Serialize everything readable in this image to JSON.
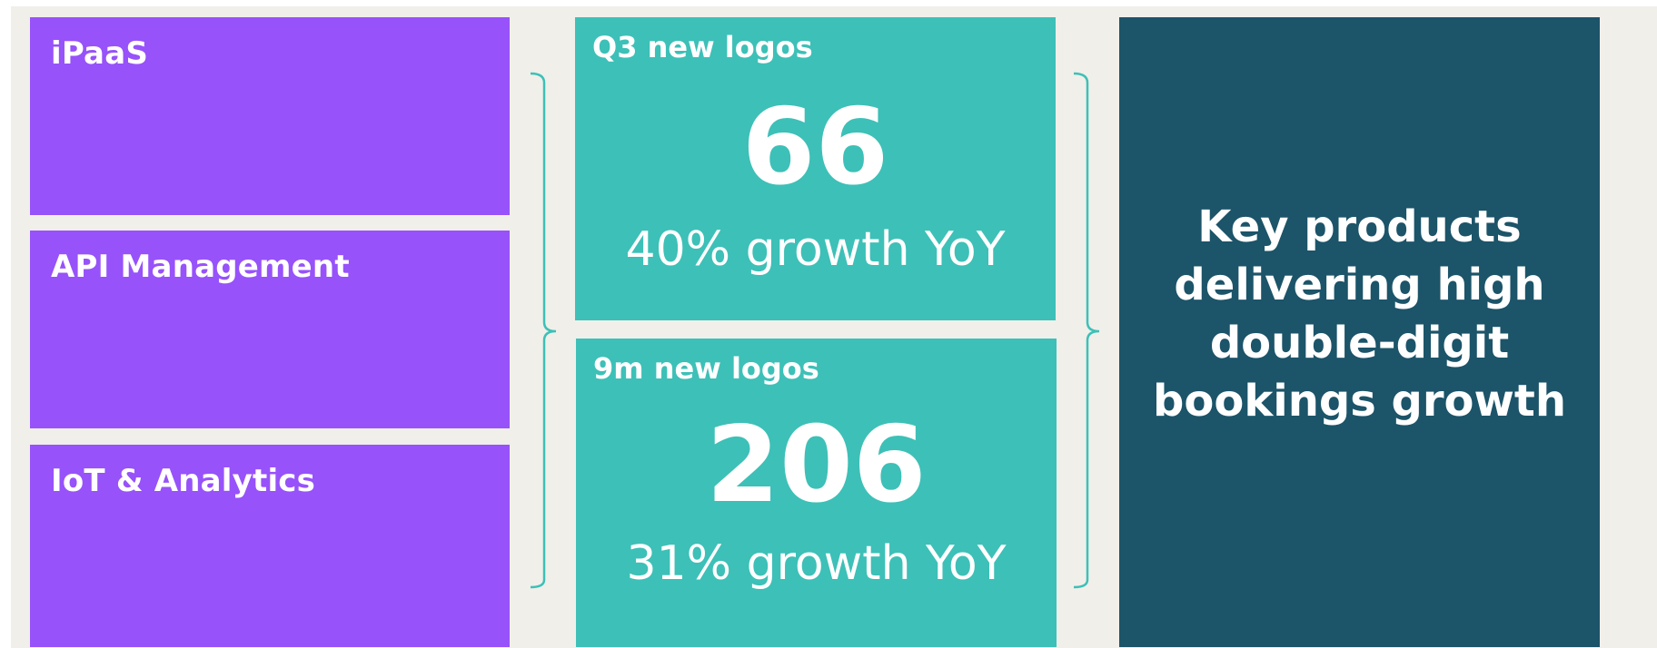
{
  "products": {
    "items": [
      {
        "label": "iPaaS"
      },
      {
        "label": "API Management"
      },
      {
        "label": "IoT & Analytics"
      }
    ]
  },
  "metrics": {
    "q3": {
      "title": "Q3 new logos",
      "value": "66",
      "growth": "40% growth YoY"
    },
    "nine_month": {
      "title": "9m new logos",
      "value": "206",
      "growth": "31% growth YoY"
    }
  },
  "summary": {
    "text": "Key products delivering high double-digit bookings growth"
  },
  "colors": {
    "background": "#f0efea",
    "product_box": "#9752fa",
    "metric_box": "#3dc0b7",
    "summary_box": "#1c5469",
    "brace": "#3dc0b7",
    "text": "#ffffff"
  }
}
